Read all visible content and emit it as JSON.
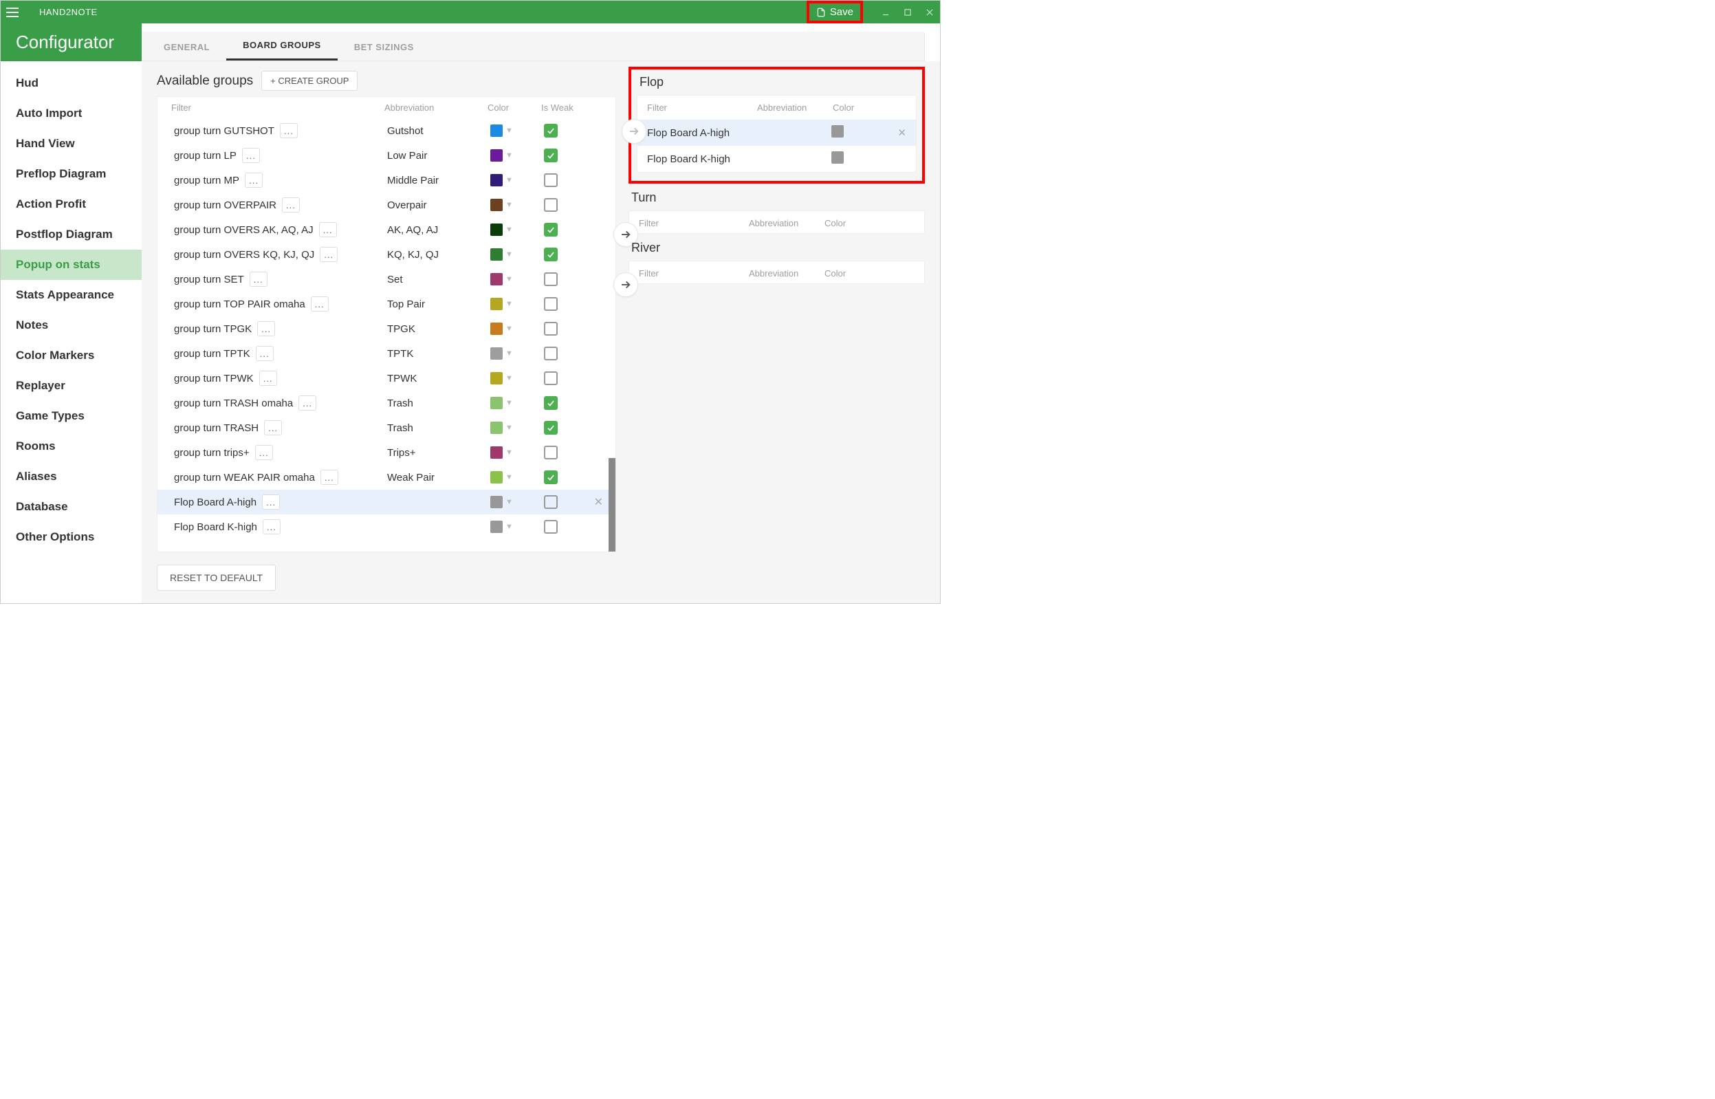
{
  "titlebar": {
    "app_name": "HAND2NOTE",
    "save_label": "Save"
  },
  "header": {
    "configurator": "Configurator",
    "tabs": [
      {
        "label": "GENERAL",
        "active": false
      },
      {
        "label": "BOARD GROUPS",
        "active": true
      },
      {
        "label": "BET SIZINGS",
        "active": false
      }
    ]
  },
  "sidebar": {
    "items": [
      "Hud",
      "Auto Import",
      "Hand View",
      "Preflop Diagram",
      "Action Profit",
      "Postflop Diagram",
      "Popup on stats",
      "Stats Appearance",
      "Notes",
      "Color Markers",
      "Replayer",
      "Game Types",
      "Rooms",
      "Aliases",
      "Database",
      "Other Options"
    ],
    "active_index": 6
  },
  "left": {
    "title": "Available groups",
    "create_btn": "+ CREATE GROUP",
    "cols": {
      "filter": "Filter",
      "abbr": "Abbreviation",
      "color": "Color",
      "weak": "Is Weak"
    },
    "rows": [
      {
        "filter": "group turn GUTSHOT",
        "abbr": "Gutshot",
        "color": "#1e88e5",
        "weak": true
      },
      {
        "filter": "group turn LP",
        "abbr": "Low Pair",
        "color": "#6a1b9a",
        "weak": true
      },
      {
        "filter": "group turn MP",
        "abbr": "Middle Pair",
        "color": "#311b7a",
        "weak": false
      },
      {
        "filter": "group turn OVERPAIR",
        "abbr": "Overpair",
        "color": "#6d4020",
        "weak": false
      },
      {
        "filter": "group turn OVERS AK, AQ, AJ",
        "abbr": "AK, AQ, AJ",
        "color": "#0b3d0b",
        "weak": true
      },
      {
        "filter": "group turn OVERS KQ, KJ, QJ",
        "abbr": "KQ, KJ, QJ",
        "color": "#2e7d32",
        "weak": true
      },
      {
        "filter": "group turn SET",
        "abbr": "Set",
        "color": "#a0396b",
        "weak": false
      },
      {
        "filter": "group turn TOP PAIR omaha",
        "abbr": "Top Pair",
        "color": "#b5a81e",
        "weak": false
      },
      {
        "filter": "group turn TPGK",
        "abbr": "TPGK",
        "color": "#c77b1e",
        "weak": false
      },
      {
        "filter": "group turn TPTK",
        "abbr": "TPTK",
        "color": "#9e9e9e",
        "weak": false
      },
      {
        "filter": "group turn TPWK",
        "abbr": "TPWK",
        "color": "#b5a81e",
        "weak": false
      },
      {
        "filter": "group turn TRASH omaha",
        "abbr": "Trash",
        "color": "#8bc46f",
        "weak": true
      },
      {
        "filter": "group turn TRASH",
        "abbr": "Trash",
        "color": "#8bc46f",
        "weak": true
      },
      {
        "filter": "group turn trips+",
        "abbr": "Trips+",
        "color": "#a0396b",
        "weak": false
      },
      {
        "filter": "group turn WEAK PAIR omaha",
        "abbr": "Weak Pair",
        "color": "#8bc34a",
        "weak": true
      },
      {
        "filter": "Flop Board A-high",
        "abbr": "",
        "color": "#989898",
        "weak": false,
        "selected": true
      },
      {
        "filter": "Flop Board K-high",
        "abbr": "",
        "color": "#989898",
        "weak": false
      }
    ],
    "reset_btn": "RESET TO DEFAULT"
  },
  "right": {
    "streets": [
      {
        "title": "Flop",
        "cols": {
          "filter": "Filter",
          "abbr": "Abbreviation",
          "color": "Color"
        },
        "rows": [
          {
            "filter": "Flop Board A-high",
            "color": "#989898",
            "hl": true,
            "del": true
          },
          {
            "filter": "Flop Board K-high",
            "color": "#989898",
            "hl": false,
            "del": false
          }
        ],
        "highlight_box": true
      },
      {
        "title": "Turn",
        "cols": {
          "filter": "Filter",
          "abbr": "Abbreviation",
          "color": "Color"
        },
        "rows": []
      },
      {
        "title": "River",
        "cols": {
          "filter": "Filter",
          "abbr": "Abbreviation",
          "color": "Color"
        },
        "rows": []
      }
    ]
  }
}
